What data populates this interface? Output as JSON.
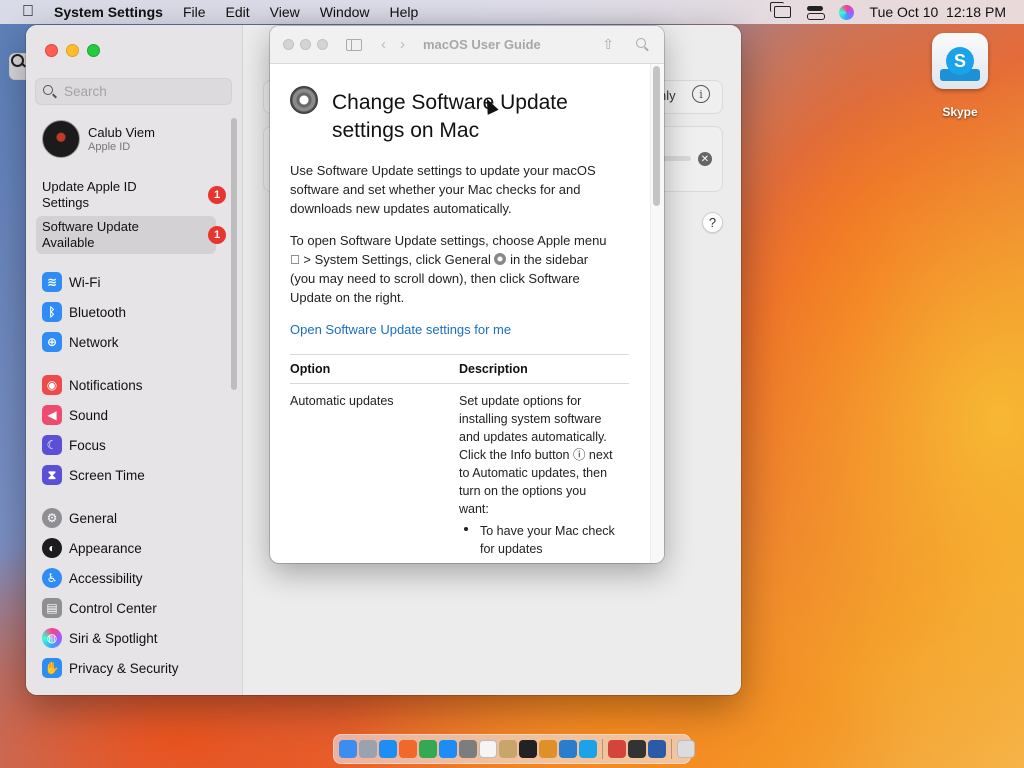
{
  "menubar": {
    "app": "System Settings",
    "items": [
      "File",
      "Edit",
      "View",
      "Window",
      "Help"
    ],
    "datetime": "Tue Oct 10  12:18 PM"
  },
  "sidebar": {
    "search_placeholder": "Search",
    "profile": {
      "name": "Calub Viem",
      "subtitle": "Apple ID"
    },
    "notices": [
      {
        "label_line1": "Update Apple ID",
        "label_line2": "Settings",
        "badge": "1"
      },
      {
        "label_line1": "Software Update",
        "label_line2": "Available",
        "badge": "1"
      }
    ],
    "items": [
      {
        "label": "Wi-Fi",
        "color": "#2f8cf5",
        "icon": "wifi-icon",
        "glyph": "≋"
      },
      {
        "label": "Bluetooth",
        "color": "#2f8cf5",
        "icon": "bluetooth-icon",
        "glyph": "ᛒ"
      },
      {
        "label": "Network",
        "color": "#2f8cf5",
        "icon": "globe-icon",
        "glyph": "⊕"
      },
      {
        "label": "Notifications",
        "color": "#ef4a4a",
        "icon": "bell-icon",
        "glyph": "◉"
      },
      {
        "label": "Sound",
        "color": "#ef4a70",
        "icon": "speaker-icon",
        "glyph": "◀"
      },
      {
        "label": "Focus",
        "color": "#5b4fd6",
        "icon": "moon-icon",
        "glyph": "☾"
      },
      {
        "label": "Screen Time",
        "color": "#5b4fd6",
        "icon": "hourglass-icon",
        "glyph": "⧗"
      },
      {
        "label": "General",
        "color": "#8e8e93",
        "icon": "gear-icon",
        "glyph": "⚙"
      },
      {
        "label": "Appearance",
        "color": "#1c1c1e",
        "icon": "appearance-icon",
        "glyph": "◐"
      },
      {
        "label": "Accessibility",
        "color": "#2f8cf5",
        "icon": "accessibility-icon",
        "glyph": "♿"
      },
      {
        "label": "Control Center",
        "color": "#8e8e93",
        "icon": "control-center-icon",
        "glyph": "▤"
      },
      {
        "label": "Siri & Spotlight",
        "color": "#7a3cc9",
        "icon": "siri-icon",
        "glyph": "◍"
      },
      {
        "label": "Privacy & Security",
        "color": "#2f8cf5",
        "icon": "hand-icon",
        "glyph": "✋"
      }
    ]
  },
  "content": {
    "partial_text": "nly",
    "help_button": "?"
  },
  "help": {
    "window_title": "macOS User Guide",
    "title_line1": "Change Software Update",
    "title_line2": "settings on Mac",
    "para1_lines": [
      "Use Software Update settings to update your macOS",
      "software and set whether your Mac checks for and",
      "downloads new updates automatically."
    ],
    "para2_lines": [
      "To open Software Update settings, choose Apple menu",
      " > System Settings, click General ",
      " in the sidebar",
      "(you may need to scroll down), then click Software",
      "Update on the right."
    ],
    "link": "Open Software Update settings for me",
    "table": {
      "col1": "Option",
      "col2": "Description",
      "row1_option": "Automatic updates",
      "row1_desc_lines": [
        "Set update options for",
        "installing system software",
        "and updates automatically.",
        "Click the Info button ⓘ next",
        "to Automatic updates, then",
        "turn on the options you",
        "want:"
      ],
      "bullet_lines": [
        "To have your Mac check",
        "for updates"
      ]
    }
  },
  "desktop": {
    "icon_label": "Skype"
  },
  "dock": {
    "apps": [
      {
        "name": "finder-icon",
        "color": "#3b8ef0"
      },
      {
        "name": "launchpad-icon",
        "color": "#9aa3ad"
      },
      {
        "name": "safari-icon",
        "color": "#1e8ef2"
      },
      {
        "name": "firefox-icon",
        "color": "#f0692a"
      },
      {
        "name": "chrome-icon",
        "color": "#34a853"
      },
      {
        "name": "app-store-icon",
        "color": "#1c8cf6"
      },
      {
        "name": "system-settings-icon",
        "color": "#7d7d7d"
      },
      {
        "name": "textedit-icon",
        "color": "#f5f5f5"
      },
      {
        "name": "instruments-icon",
        "color": "#c9a56a"
      },
      {
        "name": "terminal-icon",
        "color": "#222222"
      },
      {
        "name": "garageband-icon",
        "color": "#e0902a"
      },
      {
        "name": "vscode-icon",
        "color": "#2a7ccc"
      },
      {
        "name": "skype-dock-icon",
        "color": "#1aa3e8"
      },
      {
        "name": "pdf-app-icon",
        "color": "#d3453b"
      },
      {
        "name": "piano-icon",
        "color": "#333333"
      },
      {
        "name": "virtualbox-icon",
        "color": "#2d5aa8"
      },
      {
        "name": "trash-icon",
        "color": "#dcdcdc"
      }
    ]
  }
}
